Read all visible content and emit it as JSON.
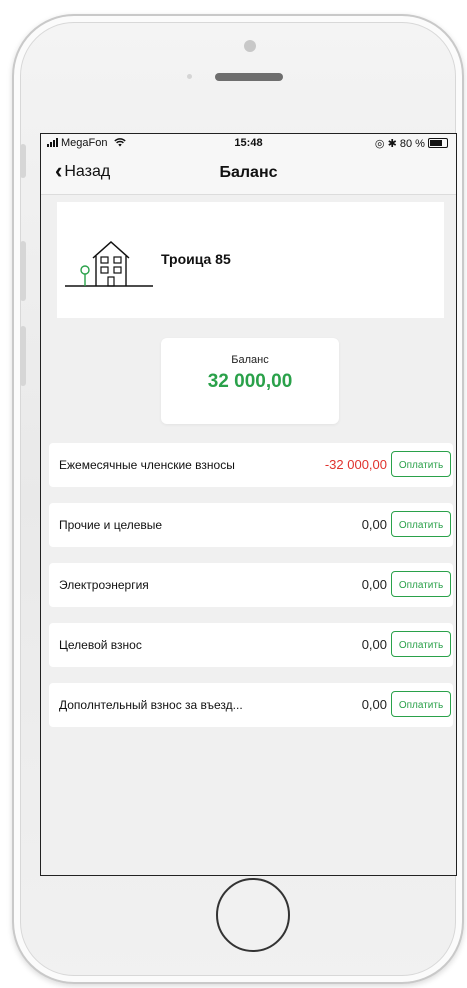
{
  "status_bar": {
    "carrier": "MegaFon",
    "time": "15:48",
    "battery": "80 %"
  },
  "nav": {
    "back_label": "Назад",
    "title": "Баланс"
  },
  "property": {
    "name": "Троица 85"
  },
  "balance": {
    "label": "Баланс",
    "value": "32 000,00"
  },
  "colors": {
    "accent_green": "#2aa14a",
    "negative_red": "#e0322d"
  },
  "rows": [
    {
      "label": "Ежемесячные членские взносы",
      "amount": "-32 000,00",
      "pay": "Оплатить"
    },
    {
      "label": "Прочие и целевые",
      "amount": "0,00",
      "pay": "Оплатить"
    },
    {
      "label": "Электроэнергия",
      "amount": "0,00",
      "pay": "Оплатить"
    },
    {
      "label": "Целевой взнос",
      "amount": "0,00",
      "pay": "Оплатить"
    },
    {
      "label": "Дополнтельный взнос за въезд...",
      "amount": "0,00",
      "pay": "Оплатить"
    }
  ]
}
